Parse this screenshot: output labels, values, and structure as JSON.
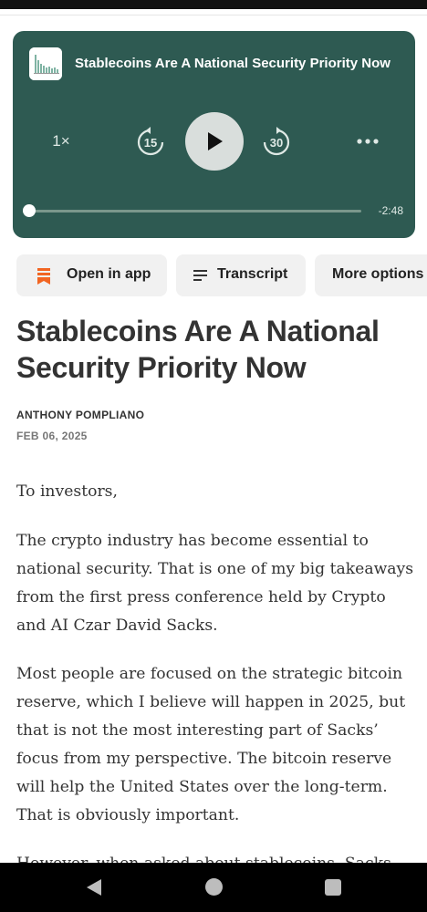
{
  "colors": {
    "player_bg": "#2e5a52",
    "accent_orange": "#f26522",
    "pill_bg": "#f1f1f1"
  },
  "player": {
    "title": "Stablecoins Are A National Security Priority Now",
    "speed": "1×",
    "skip_back_seconds": "15",
    "skip_forward_seconds": "30",
    "time_remaining": "-2:48",
    "progress_fraction": 0.0
  },
  "actions": {
    "open_in_app": "Open in app",
    "transcript": "Transcript",
    "more_options": "More options"
  },
  "article": {
    "title": "Stablecoins Are A National Security Priority Now",
    "author": "ANTHONY POMPLIANO",
    "date": "FEB 06, 2025",
    "paragraphs": [
      "To investors,",
      "The crypto industry has become essential to national security. That is one of my big takeaways from the first press conference held by Crypto and AI Czar David Sacks.",
      "Most people are focused on the strategic bitcoin reserve, which I believe will happen in 2025, but that is not the most interesting part of Sacks’ focus from my perspective. The bitcoin reserve will help the United States over the long-term. That is obviously important.",
      "However, when asked about stablecoins, Sacks made it clear that"
    ]
  },
  "icons": {
    "open_in_app": "bookmark-icon",
    "transcript": "lines-icon",
    "more": "ellipsis-icon",
    "nav_back": "triangle-back-icon",
    "nav_home": "circle-home-icon",
    "nav_recent": "square-recent-icon"
  }
}
